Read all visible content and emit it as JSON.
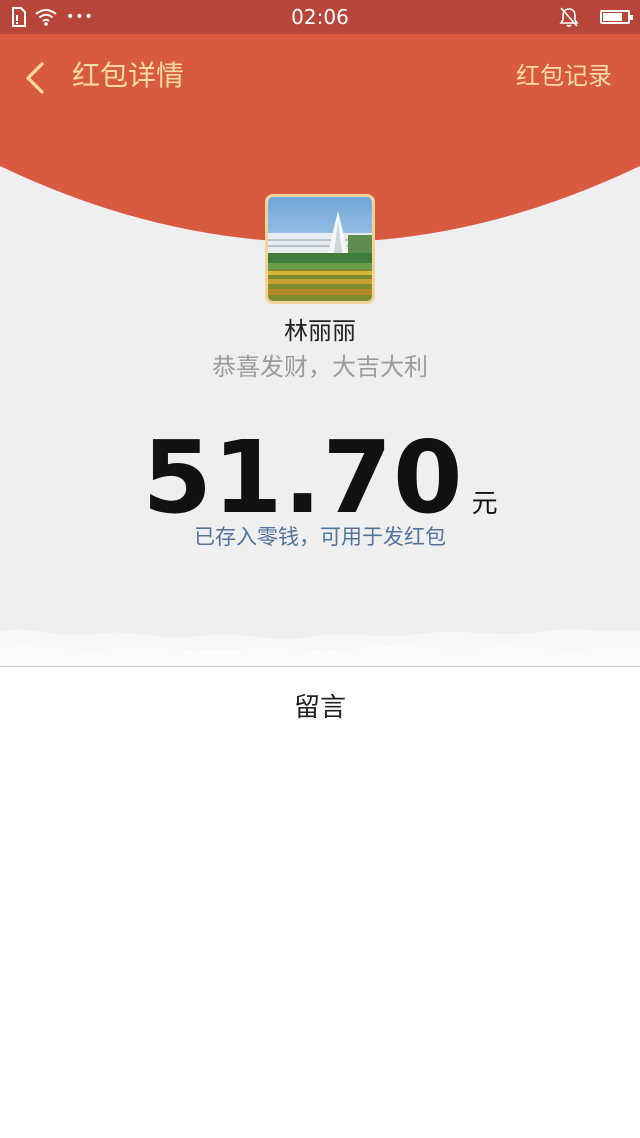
{
  "status_bar": {
    "time": "02:06",
    "icons": [
      "sim-icon",
      "wifi-icon",
      "more-dots-icon",
      "mute-bell-icon",
      "battery-icon"
    ],
    "dots": "•••",
    "battery_level": 0.8
  },
  "nav": {
    "back_icon": "chevron-left-icon",
    "title": "红包详情",
    "right_link": "红包记录"
  },
  "colors": {
    "header_red": "#d85a40",
    "status_bar": "#b8453a",
    "gold_text": "#f9dca2",
    "note_blue": "#52749b",
    "background_gray": "#efefef"
  },
  "red_packet": {
    "sender_name": "林丽丽",
    "greeting": "恭喜发财，大吉大利",
    "amount": "51.70",
    "unit": "元",
    "saved_note": "已存入零钱，可用于发红包"
  },
  "messages": {
    "label": "留言"
  }
}
